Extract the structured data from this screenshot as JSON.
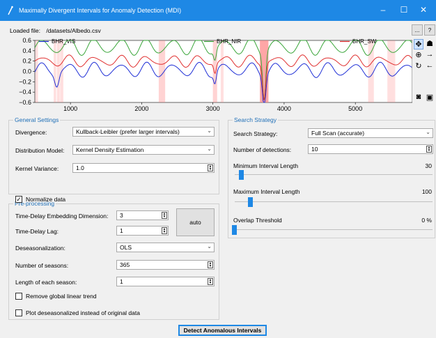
{
  "window": {
    "title": "Maximally Divergent Intervals for Anomaly Detection (MDI)",
    "minimize": "–",
    "maximize": "☐",
    "close": "✕"
  },
  "file": {
    "label": "Loaded file:",
    "path": "/datasets/Albedo.csv"
  },
  "toolbar": {
    "browse": "...",
    "help": "?"
  },
  "chart_data": {
    "type": "line",
    "series": [
      {
        "name": "BHR_VIS",
        "color": "#1f2fd6"
      },
      {
        "name": "BHR_NIR",
        "color": "#3aa63a"
      },
      {
        "name": "BHR_SW",
        "color": "#e03030"
      }
    ],
    "xticks": [
      "1000",
      "2000",
      "3000",
      "4000",
      "5000"
    ],
    "yticks": [
      "0.6",
      "0.4",
      "0.2",
      "0.0",
      "−0.2",
      "−0.4",
      "−0.6"
    ],
    "xlim": [
      500,
      5800
    ],
    "ylim": [
      -0.6,
      0.6
    ]
  },
  "plot_tools": {
    "pan": "pan-icon",
    "zoom": "zoom-icon",
    "forward": "forward-icon",
    "back": "back-icon",
    "home": "home-icon",
    "reset": "reset-icon",
    "screenshot": "camera-icon",
    "save": "save-icon"
  },
  "general": {
    "title": "General Settings",
    "divergence_label": "Divergence:",
    "divergence_value": "Kullback-Leibler (prefer larger intervals)",
    "model_label": "Distribution Model:",
    "model_value": "Kernel Density Estimation",
    "variance_label": "Kernel Variance:",
    "variance_value": "1.0"
  },
  "pre": {
    "title": "Pre-processing",
    "normalize_label": "Normalize data",
    "normalize_checked": "✓",
    "embed_label": "Time-Delay Embedding Dimension:",
    "embed_value": "3",
    "lag_label": "Time-Delay Lag:",
    "lag_value": "1",
    "auto_label": "auto",
    "deseason_label": "Deseasonalization:",
    "deseason_value": "OLS",
    "seasons_label": "Number of seasons:",
    "seasons_value": "365",
    "season_len_label": "Length of each season:",
    "season_len_value": "1",
    "trend_label": "Remove global linear trend",
    "plot_deseason_label": "Plot deseasonalized instead of original data"
  },
  "search": {
    "title": "Search Strategy",
    "strategy_label": "Search Strategy:",
    "strategy_value": "Full Scan (accurate)",
    "detections_label": "Number of detections:",
    "detections_value": "10",
    "min_len_label": "Minimum Interval Length",
    "min_len_value": "30",
    "min_len_fraction": 0.02,
    "max_len_label": "Maximum Interval Length",
    "max_len_value": "100",
    "max_len_fraction": 0.07,
    "overlap_label": "Overlap Threshold",
    "overlap_value": "0 %",
    "overlap_fraction": 0.0
  },
  "detect_label": "Detect Anomalous Intervals"
}
